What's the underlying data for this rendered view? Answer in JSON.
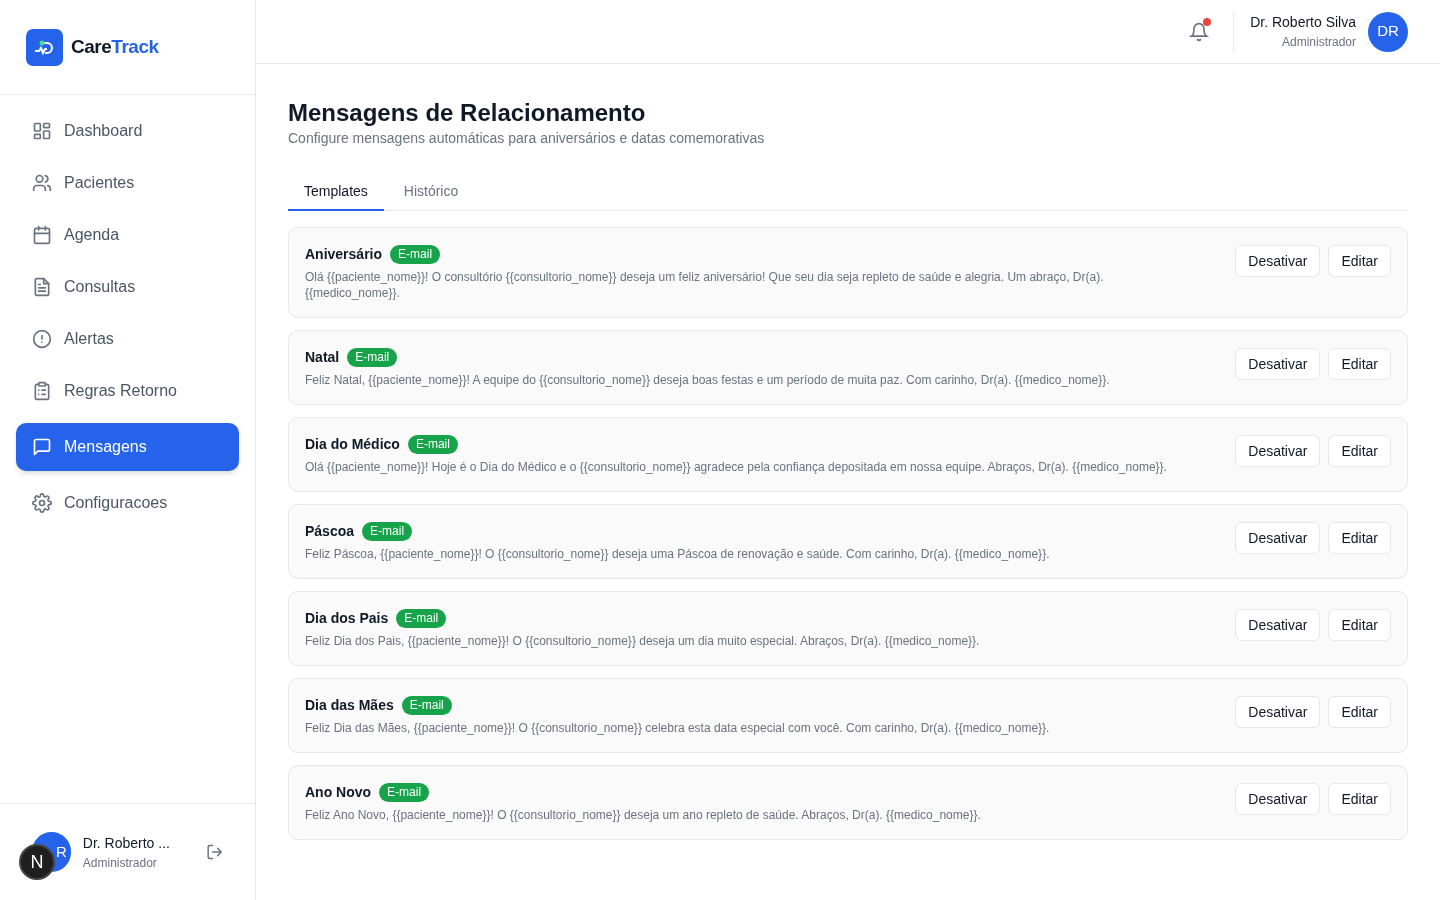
{
  "brand": {
    "name_part_1": "Care",
    "name_part_2": "Track"
  },
  "sidebar": {
    "items": [
      {
        "label": "Dashboard",
        "selected": false
      },
      {
        "label": "Pacientes",
        "selected": false
      },
      {
        "label": "Agenda",
        "selected": false
      },
      {
        "label": "Consultas",
        "selected": false
      },
      {
        "label": "Alertas",
        "selected": false
      },
      {
        "label": "Regras Retorno",
        "selected": false
      },
      {
        "label": "Mensagens",
        "selected": true
      },
      {
        "label": "Configuracoes",
        "selected": false
      }
    ],
    "user": {
      "avatar_visible_initial": "R",
      "name": "Dr. Roberto ...",
      "role": "Administrador",
      "dev_badge": "N"
    }
  },
  "header": {
    "notification_dot": true,
    "user_name": "Dr. Roberto Silva",
    "user_role": "Administrador",
    "avatar": "DR"
  },
  "page": {
    "title": "Mensagens de Relacionamento",
    "subtitle": "Configure mensagens automáticas para aniversários e datas comemorativas"
  },
  "tabs": [
    {
      "label": "Templates",
      "selected": true
    },
    {
      "label": "Histórico",
      "selected": false
    }
  ],
  "templates": [
    {
      "name": "Aniversário",
      "channel": "E-mail",
      "message": "Olá {{paciente_nome}}! O consultório {{consultorio_nome}} deseja um feliz aniversário! Que seu dia seja repleto de saúde e alegria. Um abraço, Dr(a). {{medico_nome}}.",
      "actions": [
        "Desativar",
        "Editar"
      ]
    },
    {
      "name": "Natal",
      "channel": "E-mail",
      "message": "Feliz Natal, {{paciente_nome}}! A equipe do {{consultorio_nome}} deseja boas festas e um período de muita paz. Com carinho, Dr(a). {{medico_nome}}.",
      "actions": [
        "Desativar",
        "Editar"
      ]
    },
    {
      "name": "Dia do Médico",
      "channel": "E-mail",
      "message": "Olá {{paciente_nome}}! Hoje é o Dia do Médico e o {{consultorio_nome}} agradece pela confiança depositada em nossa equipe. Abraços, Dr(a). {{medico_nome}}.",
      "actions": [
        "Desativar",
        "Editar"
      ]
    },
    {
      "name": "Páscoa",
      "channel": "E-mail",
      "message": "Feliz Páscoa, {{paciente_nome}}! O {{consultorio_nome}} deseja uma Páscoa de renovação e saúde. Com carinho, Dr(a). {{medico_nome}}.",
      "actions": [
        "Desativar",
        "Editar"
      ]
    },
    {
      "name": "Dia dos Pais",
      "channel": "E-mail",
      "message": "Feliz Dia dos Pais, {{paciente_nome}}! O {{consultorio_nome}} deseja um dia muito especial. Abraços, Dr(a). {{medico_nome}}.",
      "actions": [
        "Desativar",
        "Editar"
      ]
    },
    {
      "name": "Dia das Mães",
      "channel": "E-mail",
      "message": "Feliz Dia das Mães, {{paciente_nome}}! O {{consultorio_nome}} celebra esta data especial com você. Com carinho, Dr(a). {{medico_nome}}.",
      "actions": [
        "Desativar",
        "Editar"
      ]
    },
    {
      "name": "Ano Novo",
      "channel": "E-mail",
      "message": "Feliz Ano Novo, {{paciente_nome}}! O {{consultorio_nome}} deseja um ano repleto de saúde. Abraços, Dr(a). {{medico_nome}}.",
      "actions": [
        "Desativar",
        "Editar"
      ]
    }
  ]
}
